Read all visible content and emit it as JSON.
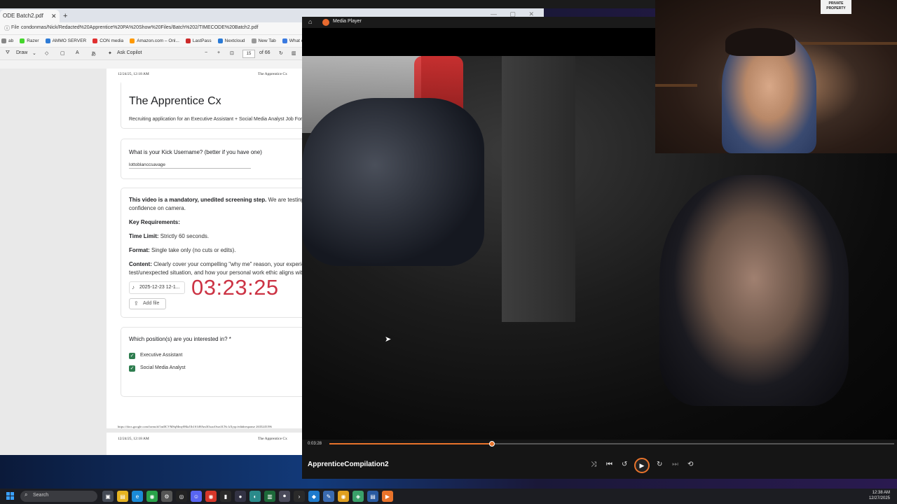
{
  "browser": {
    "tab_title": "ODE Batch2.pdf",
    "tab_close": "✕",
    "new_tab": "+",
    "address_label": "File",
    "address_url": "condonmas/Nick/Redacted%20Apprentice%20PA%20Show%20Files/Batch%202/TIMECODE%20Batch2.pdf",
    "bookmarks": [
      {
        "label": "ab",
        "color": "#888888"
      },
      {
        "label": "Razer",
        "color": "#44d62c"
      },
      {
        "label": "AMMO SERVER",
        "color": "#2e7bd6"
      },
      {
        "label": "CON media",
        "color": "#e03030"
      },
      {
        "label": "Amazon.com – Onl...",
        "color": "#ff9900"
      },
      {
        "label": "LastPass",
        "color": "#cc2a2a"
      },
      {
        "label": "Nextcloud",
        "color": "#2a7ad6"
      },
      {
        "label": "New Tab",
        "color": "#999999"
      },
      {
        "label": "What can the",
        "color": "#3a7ae0"
      }
    ],
    "pdf_toolbar": {
      "draw": "Draw",
      "ask_copilot": "Ask Copilot",
      "page": "15",
      "of_pages": "of 66",
      "minus": "−",
      "plus": "+"
    }
  },
  "pdf": {
    "header_date": "12/24/25, 12:18 AM",
    "header_title": "The Apprentice Cx",
    "form_title": "The Apprentice Cx",
    "form_subtitle": "Recruiting application for an Executive Assistant + Social Media Analyst Job Format",
    "q1": "What is your Kick Username? (better if you have one)",
    "a1": "lottoblanccsavage",
    "video_intro_bold": "This video is a mandatory, unedited screening step.",
    "video_intro_rest": " We are testing",
    "video_intro_2": "confidence on camera.",
    "key_req": "Key Requirements:",
    "time_limit_label": "Time Limit:",
    "time_limit_value": " Strictly 60 seconds.",
    "format_label": "Format:",
    "format_value": " Single take only (no cuts or edits).",
    "content_label": "Content:",
    "content_value": " Clearly cover your compelling \"why me\" reason, your experie",
    "content_value_2": "test/unexpected situation, and how your personal work ethic aligns wit",
    "file_name": "2025-12-23 12-1...",
    "add_file": "Add file",
    "timecode": "03:23:25",
    "q_positions": "Which position(s) are you interested in? *",
    "positions": [
      "Executive Assistant",
      "Social Media Analyst"
    ],
    "footer_url": "https://docs.google.com/forms/d/1mIICVMSqMmy0MaJ1h1S1iHAm3OxaoOwn3CNc kXyqc/edit#response  2635245196",
    "page2_date": "12/24/25, 12:18 AM",
    "page2_title": "The Apprentice Cx"
  },
  "player": {
    "app_title": "Media Player",
    "current_time": "0:03:28",
    "progress": 0.288,
    "video_name": "ApprenticeCompilation2",
    "accent": "#e8732b"
  },
  "webcam": {
    "sign_text": "PRIVATE PROPERTY"
  },
  "taskbar": {
    "search_placeholder": "Search",
    "time": "12:38 AM",
    "date": "12/27/2025",
    "apps": [
      {
        "name": "task-view-icon",
        "color": "#444a55",
        "glyph": "▣"
      },
      {
        "name": "file-explorer-icon",
        "color": "#e6b422",
        "glyph": "▤"
      },
      {
        "name": "edge-icon",
        "color": "#1b8ad6",
        "glyph": "e"
      },
      {
        "name": "chrome-icon",
        "color": "#2aa34a",
        "glyph": "◉"
      },
      {
        "name": "settings-icon",
        "color": "#555555",
        "glyph": "⚙"
      },
      {
        "name": "github-icon",
        "color": "#222222",
        "glyph": "◎"
      },
      {
        "name": "discord-icon",
        "color": "#5865f2",
        "glyph": "☺"
      },
      {
        "name": "chrome-alt-icon",
        "color": "#d6372a",
        "glyph": "◉"
      },
      {
        "name": "app-icon",
        "color": "#2a2a2a",
        "glyph": "▮"
      },
      {
        "name": "obs-icon",
        "color": "#333344",
        "glyph": "●"
      },
      {
        "name": "browser-icon",
        "color": "#2a8a8a",
        "glyph": "◐"
      },
      {
        "name": "stats-icon",
        "color": "#1d6a3a",
        "glyph": "▥"
      },
      {
        "name": "recorder-icon",
        "color": "#4a4a5a",
        "glyph": "⏺"
      },
      {
        "name": "terminal-icon",
        "color": "#2a2a2a",
        "glyph": "›"
      },
      {
        "name": "vscode-icon",
        "color": "#1e7acc",
        "glyph": "◆"
      },
      {
        "name": "pen-icon",
        "color": "#3a6ab0",
        "glyph": "✎"
      },
      {
        "name": "chrome-canary-icon",
        "color": "#e0a020",
        "glyph": "◉"
      },
      {
        "name": "widgets-icon",
        "color": "#3aa06a",
        "glyph": "◈"
      },
      {
        "name": "notes-icon",
        "color": "#2a5aa0",
        "glyph": "▤"
      },
      {
        "name": "media-player-icon",
        "color": "#e8732b",
        "glyph": "▶"
      }
    ]
  }
}
